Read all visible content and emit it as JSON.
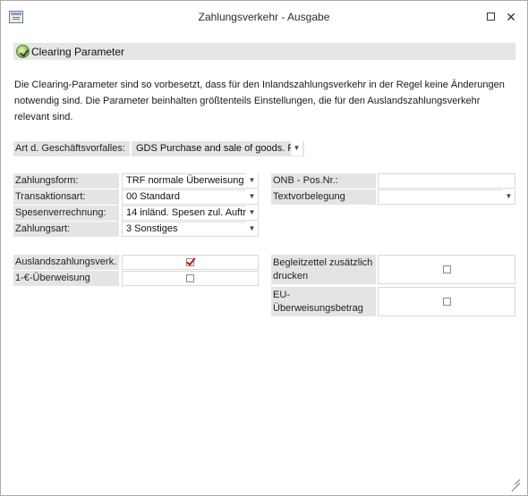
{
  "window": {
    "title": "Zahlungsverkehr - Ausgabe"
  },
  "section": {
    "label": "Clearing Parameter"
  },
  "description": "Die Clearing-Parameter sind so vorbesetzt, dass für den Inlandszahlungsverkehr in der Regel keine Änderungen notwendig sind. Die Parameter beinhalten größtenteils Einstellungen, die für den Auslandszahlungsverkehr relevant sind.",
  "geschaeftsvorfall": {
    "label": "Art d. Geschäftsvorfalles:",
    "value": "GDS  Purchase and sale of goods. P"
  },
  "left_fields": [
    {
      "label": "Zahlungsform:",
      "value": "TRF  normale Überweisung"
    },
    {
      "label": "Transaktionsart:",
      "value": "00 Standard"
    },
    {
      "label": "Spesenverrechnung:",
      "value": "14  inländ. Spesen zul. Auftr"
    },
    {
      "label": "Zahlungsart:",
      "value": "3 Sonstiges"
    }
  ],
  "right_fields": [
    {
      "label": "ONB - Pos.Nr.:",
      "value": ""
    },
    {
      "label": "Textvorbelegung",
      "value": ""
    }
  ],
  "checkboxes_left": [
    {
      "label": "Auslandszahlungsverk.",
      "checked": true
    },
    {
      "label": "1-€-Überweisung",
      "checked": false
    }
  ],
  "checkboxes_right": [
    {
      "label": "Begleitzettel zusätzlich drucken",
      "checked": false
    },
    {
      "label": "EU-Überweisungsbetrag berücksichtigen",
      "checked": false
    }
  ]
}
